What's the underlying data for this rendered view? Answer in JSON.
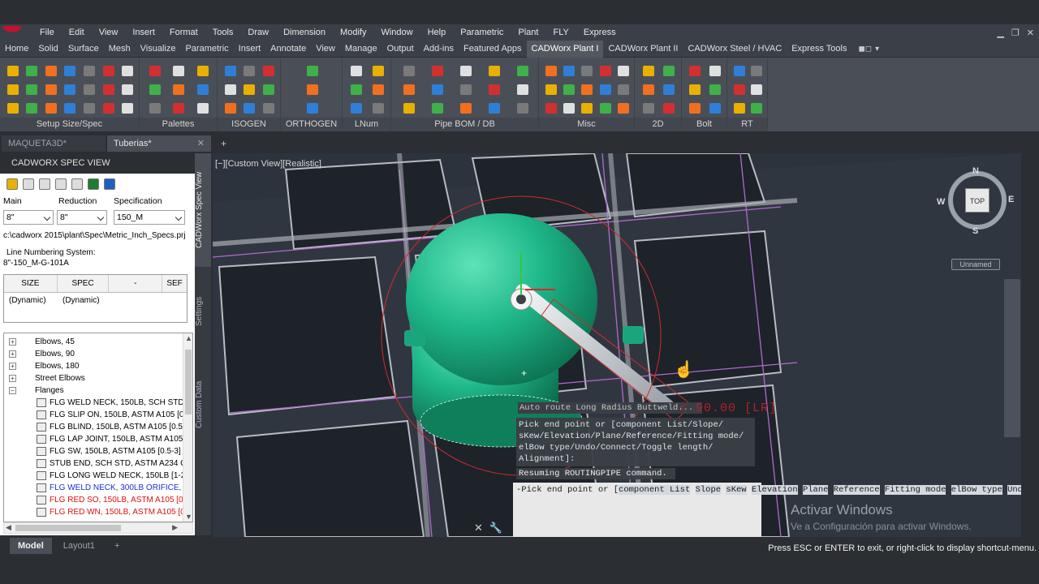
{
  "menubar": [
    "File",
    "Edit",
    "View",
    "Insert",
    "Format",
    "Tools",
    "Draw",
    "Dimension",
    "Modify",
    "Window",
    "Help",
    "Parametric",
    "Plant",
    "FLY",
    "Express"
  ],
  "ribbon_tabs": [
    "Home",
    "Solid",
    "Surface",
    "Mesh",
    "Visualize",
    "Parametric",
    "Insert",
    "Annotate",
    "View",
    "Manage",
    "Output",
    "Add-ins",
    "Featured Apps",
    "CADWorx Plant I",
    "CADWorx Plant II",
    "CADWorx Steel / HVAC",
    "Express Tools"
  ],
  "ribbon_active_tab": "CADWorx Plant I",
  "ribbon_panels": [
    "Setup Size/Spec",
    "Palettes",
    "ISOGEN",
    "ORTHOGEN",
    "LNum",
    "Pipe BOM / DB",
    "Misc",
    "2D",
    "Bolt",
    "RT"
  ],
  "doc_tabs": [
    {
      "label": "MAQUETA3D*",
      "active": false
    },
    {
      "label": "Tuberias*",
      "active": true
    }
  ],
  "palette": {
    "title": "CADWORX SPEC VIEW",
    "labels": {
      "main": "Main",
      "reduction": "Reduction",
      "specification": "Specification"
    },
    "values": {
      "main": "8\"",
      "reduction": "8\"",
      "specification": "150_M"
    },
    "path": "c:\\cadworx 2015\\plant\\Spec\\Metric_Inch_Specs.prj",
    "line_numbering_label": "Line Numbering System:",
    "line_numbering_value": "8\"-150_M-G-101A",
    "table_headers": [
      "SIZE",
      "SPEC",
      "-",
      "SEF"
    ],
    "table_row": [
      "(Dynamic)",
      "(Dynamic)"
    ],
    "tree": [
      {
        "label": "Elbows, 45",
        "level": 1,
        "exp": "+"
      },
      {
        "label": "Elbows, 90",
        "level": 1,
        "exp": "+"
      },
      {
        "label": "Elbows, 180",
        "level": 1,
        "exp": "+"
      },
      {
        "label": "Street Elbows",
        "level": 1,
        "exp": "+"
      },
      {
        "label": "Flanges",
        "level": 1,
        "exp": "−"
      },
      {
        "label": "FLG WELD NECK, 150LB, SCH STD, ...",
        "level": 2,
        "color": "black"
      },
      {
        "label": "FLG SLIP ON, 150LB, ASTM A105 [0.",
        "level": 2,
        "color": "black"
      },
      {
        "label": "FLG BLIND, 150LB, ASTM A105 [0.5",
        "level": 2,
        "color": "black"
      },
      {
        "label": "FLG LAP JOINT, 150LB, ASTM A105",
        "level": 2,
        "color": "black"
      },
      {
        "label": "FLG SW, 150LB, ASTM A105 [0.5-3]",
        "level": 2,
        "color": "black"
      },
      {
        "label": "STUB END, SCH STD, ASTM A234 GI",
        "level": 2,
        "color": "black"
      },
      {
        "label": "FLG LONG WELD NECK, 150LB [1-20",
        "level": 2,
        "color": "black"
      },
      {
        "label": "FLG WELD NECK, 300LB ORIFICE, A",
        "level": 2,
        "color": "blue"
      },
      {
        "label": "FLG RED SO, 150LB, ASTM A105 [0.",
        "level": 2,
        "color": "red"
      },
      {
        "label": "FLG RED WN, 150LB, ASTM A105 [0.",
        "level": 2,
        "color": "red"
      }
    ]
  },
  "vtabs": [
    "CADWorx Spec View",
    "Settings",
    "Custom Data"
  ],
  "viewport": {
    "label": "[−][Custom View][Realistic]",
    "viewcube": {
      "n": "N",
      "s": "S",
      "e": "E",
      "w": "W",
      "face": "TOP",
      "ucs": "Unnamed"
    },
    "dyn_prompt": "Auto route Long Radius Buttweld...",
    "dyn_value": "< 90.00 [LR]",
    "history_text": "Pick end point or [component List/Slope/\nsKew/Elevation/Plane/Reference/Fitting mode/\nelBow type/Undo/Connect/Toggle length/\nAlignment]:",
    "resume_text": "Resuming ROUTINGPIPE command.",
    "cmd_prefix": "-Pick end point or [",
    "cmd_keywords": [
      "component List",
      "Slope",
      "sKew",
      "Elevation",
      "Plane",
      "Reference",
      "Fitting mode",
      "elBow type",
      "Undo",
      "Connect",
      "Toggle length"
    ],
    "cmd_suffix": "Alignment]:",
    "activate_title": "Activar Windows",
    "activate_sub": "Ve a Configuración para activar Windows."
  },
  "layout_tabs": [
    {
      "label": "Model",
      "active": true
    },
    {
      "label": "Layout1",
      "active": false
    }
  ],
  "status_text": "Press ESC or ENTER to exit, or right-click to display shortcut-menu.",
  "colors": {
    "vessel": "#1fb88a",
    "pipe": "#d8dde2",
    "grid_magenta": "#b06ad0",
    "crosshair_red": "#d12b2b"
  }
}
